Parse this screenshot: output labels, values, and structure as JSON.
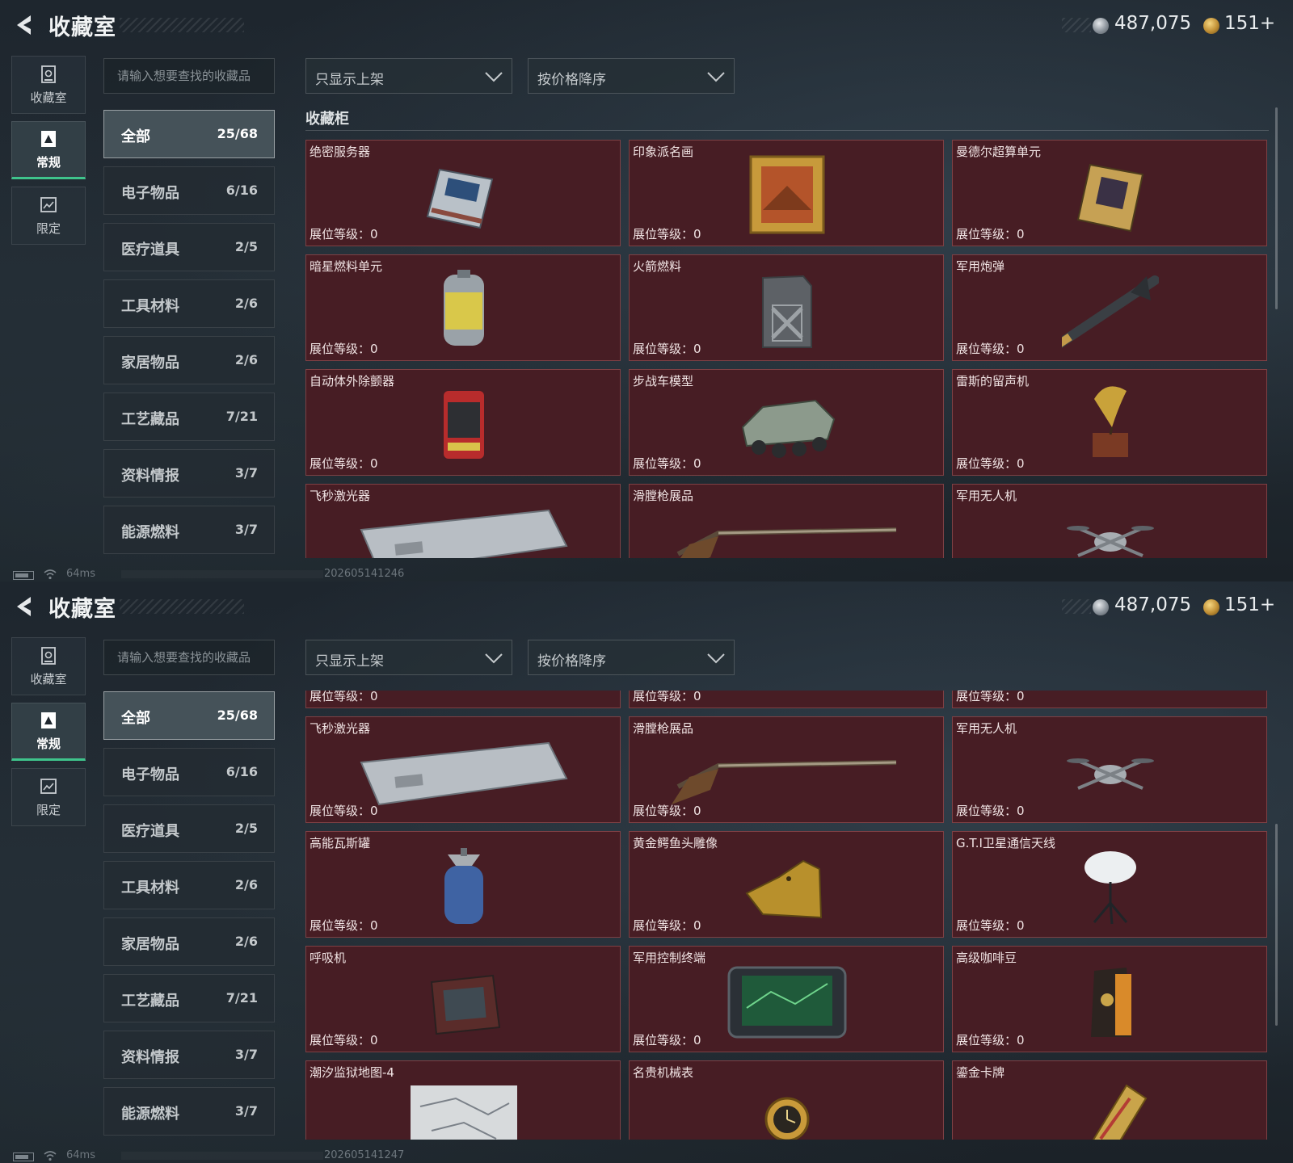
{
  "header": {
    "title": "收藏室",
    "silver_balance": "487,075",
    "gold_balance": "151+"
  },
  "rail": {
    "items": [
      {
        "label": "收藏室",
        "icon": "vault-icon"
      },
      {
        "label": "常规",
        "icon": "regular-icon",
        "active": true
      },
      {
        "label": "限定",
        "icon": "limited-icon"
      }
    ]
  },
  "search": {
    "placeholder": "请输入想要查找的收藏品"
  },
  "filters": {
    "display": "只显示上架",
    "sort": "按价格降序"
  },
  "categories": [
    {
      "label": "全部",
      "count": "25/68",
      "active": true
    },
    {
      "label": "电子物品",
      "count": "6/16"
    },
    {
      "label": "医疗道具",
      "count": "2/5"
    },
    {
      "label": "工具材料",
      "count": "2/6"
    },
    {
      "label": "家居物品",
      "count": "2/6"
    },
    {
      "label": "工艺藏品",
      "count": "7/21"
    },
    {
      "label": "资料情报",
      "count": "3/7"
    },
    {
      "label": "能源燃料",
      "count": "3/7"
    }
  ],
  "section": {
    "title": "收藏柜"
  },
  "level_label": "展位等级：0",
  "items": [
    {
      "name": "绝密服务器",
      "icon": "server-icon"
    },
    {
      "name": "印象派名画",
      "icon": "painting-icon"
    },
    {
      "name": "曼德尔超算单元",
      "icon": "cpu-icon"
    },
    {
      "name": "暗星燃料单元",
      "icon": "fuel-cell-icon"
    },
    {
      "name": "火箭燃料",
      "icon": "jerrycan-icon"
    },
    {
      "name": "军用炮弹",
      "icon": "missile-icon"
    },
    {
      "name": "自动体外除颤器",
      "icon": "defibrillator-icon"
    },
    {
      "name": "步战车模型",
      "icon": "armored-vehicle-icon"
    },
    {
      "name": "雷斯的留声机",
      "icon": "gramophone-icon"
    },
    {
      "name": "飞秒激光器",
      "icon": "laser-case-icon"
    },
    {
      "name": "滑膛枪展品",
      "icon": "musket-icon"
    },
    {
      "name": "军用无人机",
      "icon": "drone-icon"
    },
    {
      "name": "高能瓦斯罐",
      "icon": "gas-tank-icon"
    },
    {
      "name": "黄金鳄鱼头雕像",
      "icon": "crocodile-statue-icon"
    },
    {
      "name": "G.T.I卫星通信天线",
      "icon": "satellite-dish-icon"
    },
    {
      "name": "呼吸机",
      "icon": "ventilator-icon"
    },
    {
      "name": "军用控制终端",
      "icon": "terminal-icon"
    },
    {
      "name": "高级咖啡豆",
      "icon": "coffee-bag-icon"
    },
    {
      "name": "潮汐监狱地图-4",
      "icon": "map-icon"
    },
    {
      "name": "名贵机械表",
      "icon": "watch-icon"
    },
    {
      "name": "鎏金卡牌",
      "icon": "gold-card-icon"
    }
  ],
  "status": {
    "ping": "64ms",
    "timestamps": [
      "202605141246",
      "202605141247"
    ]
  },
  "colors": {
    "card_bg": "#471d24",
    "accent": "#3fc48c",
    "panel": "#232c34"
  }
}
